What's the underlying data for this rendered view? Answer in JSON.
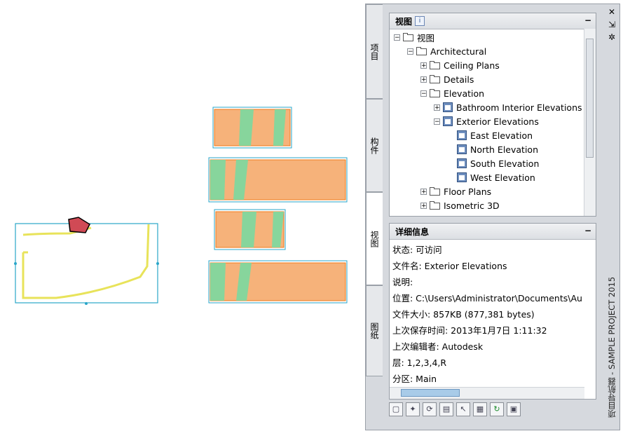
{
  "tabs": [
    {
      "label": "项目"
    },
    {
      "label": "构件"
    },
    {
      "label": "视图"
    },
    {
      "label": "图纸"
    }
  ],
  "views_panel": {
    "title": "视图",
    "info": "i",
    "minimize": "−",
    "tree": [
      {
        "label": "视图",
        "expander": "−"
      },
      {
        "label": "Architectural",
        "expander": "−"
      },
      {
        "label": "Ceiling Plans",
        "expander": "+"
      },
      {
        "label": "Details",
        "expander": "+"
      },
      {
        "label": "Elevation",
        "expander": "−"
      },
      {
        "label": "Bathroom Interior Elevations",
        "expander": "+"
      },
      {
        "label": "Exterior Elevations",
        "expander": "−"
      },
      {
        "label": "East Elevation"
      },
      {
        "label": "North Elevation"
      },
      {
        "label": "South Elevation"
      },
      {
        "label": "West Elevation"
      },
      {
        "label": "Floor Plans",
        "expander": "+"
      },
      {
        "label": "Isometric 3D",
        "expander": "+"
      }
    ]
  },
  "details_panel": {
    "title": "详细信息",
    "minimize": "−",
    "rows": [
      {
        "text": "状态: 可访问"
      },
      {
        "text": "文件名: Exterior Elevations"
      },
      {
        "text": "说明:"
      },
      {
        "text": "位置: C:\\Users\\Administrator\\Documents\\Autod"
      },
      {
        "text": "文件大小: 857KB (877,381 bytes)"
      },
      {
        "text": "上次保存时间: 2013年1月7日   1:11:32"
      },
      {
        "text": "上次编辑者: Autodesk"
      },
      {
        "text": "层: 1,2,3,4,R"
      },
      {
        "text": "分区: Main"
      }
    ]
  },
  "side": {
    "title": "项目导航器 - SAMPLE PROJECT 2015",
    "close": "✕",
    "pin": "⇲",
    "gear": "✲"
  },
  "colors": {
    "accent": "#2aa6c9",
    "drawing": "#f07a1a",
    "fill": "#7bd9a0"
  }
}
